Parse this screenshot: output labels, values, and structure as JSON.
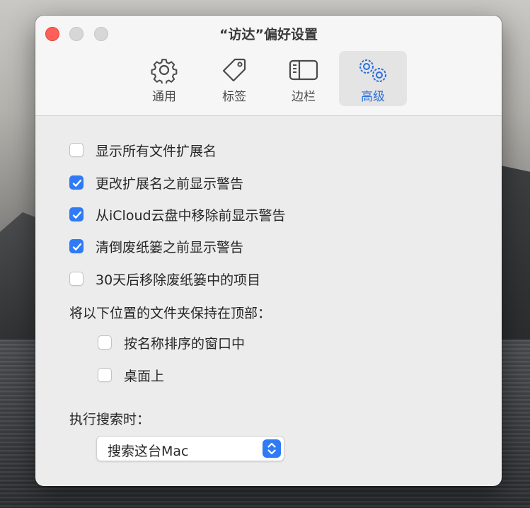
{
  "window": {
    "title": "“访达”偏好设置"
  },
  "tabs": [
    {
      "label": "通用",
      "icon": "gear-icon",
      "active": false
    },
    {
      "label": "标签",
      "icon": "tag-icon",
      "active": false
    },
    {
      "label": "边栏",
      "icon": "sidebar-icon",
      "active": false
    },
    {
      "label": "高级",
      "icon": "gears-icon",
      "active": true
    }
  ],
  "options": [
    {
      "label": "显示所有文件扩展名",
      "checked": false
    },
    {
      "label": "更改扩展名之前显示警告",
      "checked": true
    },
    {
      "label": "从iCloud云盘中移除前显示警告",
      "checked": true
    },
    {
      "label": "清倒废纸篓之前显示警告",
      "checked": true
    },
    {
      "label": "30天后移除废纸篓中的项目",
      "checked": false
    }
  ],
  "folders_on_top": {
    "heading": "将以下位置的文件夹保持在顶部：",
    "items": [
      {
        "label": "按名称排序的窗口中",
        "checked": false
      },
      {
        "label": "桌面上",
        "checked": false
      }
    ]
  },
  "search": {
    "label": "执行搜索时：",
    "selected": "搜索这台Mac"
  },
  "colors": {
    "accent": "#2f7bf5",
    "close": "#fe5f57"
  }
}
